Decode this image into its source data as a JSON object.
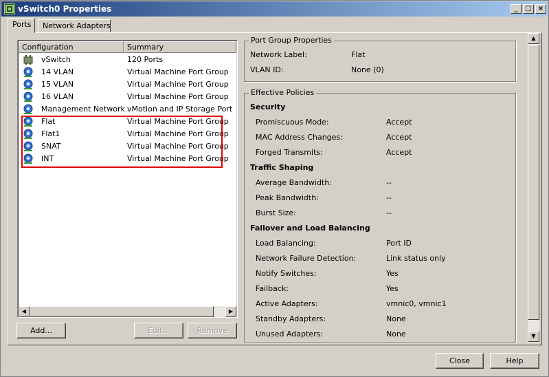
{
  "window": {
    "title": "vSwitch0 Properties",
    "controls": {
      "minimize": "_",
      "maximize": "□",
      "close": "×"
    }
  },
  "tabs": [
    {
      "label": "Ports",
      "active": true
    },
    {
      "label": "Network Adapters",
      "active": false
    }
  ],
  "ports_list": {
    "columns": [
      "Configuration",
      "Summary"
    ],
    "rows": [
      {
        "name": "vSwitch",
        "summary": "120 Ports",
        "icon": "vswitch-icon"
      },
      {
        "name": "14 VLAN",
        "summary": "Virtual Machine Port Group",
        "icon": "port-group-icon"
      },
      {
        "name": "15 VLAN",
        "summary": "Virtual Machine Port Group",
        "icon": "port-group-icon"
      },
      {
        "name": "16 VLAN",
        "summary": "Virtual Machine Port Group",
        "icon": "port-group-icon"
      },
      {
        "name": "Management Network",
        "summary": "vMotion and IP Storage Port",
        "icon": "port-group-icon"
      },
      {
        "name": "Flat",
        "summary": "Virtual Machine Port Group",
        "icon": "port-group-icon"
      },
      {
        "name": "Flat1",
        "summary": "Virtual Machine Port Group",
        "icon": "port-group-icon"
      },
      {
        "name": "SNAT",
        "summary": "Virtual Machine Port Group",
        "icon": "port-group-icon"
      },
      {
        "name": "INT",
        "summary": "Virtual Machine Port Group",
        "icon": "port-group-icon"
      }
    ]
  },
  "buttons": {
    "add": "Add...",
    "edit": "Edit...",
    "remove": "Remove",
    "close": "Close",
    "help": "Help"
  },
  "port_group_properties": {
    "legend": "Port Group Properties",
    "network_label_key": "Network Label:",
    "network_label_value": "Flat",
    "vlan_id_key": "VLAN ID:",
    "vlan_id_value": "None (0)"
  },
  "effective_policies": {
    "legend": "Effective Policies",
    "security": {
      "title": "Security",
      "promiscuous_key": "Promiscuous Mode:",
      "promiscuous_value": "Accept",
      "mac_key": "MAC Address Changes:",
      "mac_value": "Accept",
      "forged_key": "Forged Transmits:",
      "forged_value": "Accept"
    },
    "traffic_shaping": {
      "title": "Traffic Shaping",
      "avg_key": "Average Bandwidth:",
      "avg_value": "--",
      "peak_key": "Peak Bandwidth:",
      "peak_value": "--",
      "burst_key": "Burst Size:",
      "burst_value": "--"
    },
    "failover": {
      "title": "Failover and Load Balancing",
      "lb_key": "Load Balancing:",
      "lb_value": "Port ID",
      "nfd_key": "Network Failure Detection:",
      "nfd_value": "Link status only",
      "notify_key": "Notify Switches:",
      "notify_value": "Yes",
      "failback_key": "Failback:",
      "failback_value": "Yes",
      "active_key": "Active Adapters:",
      "active_value": "vmnic0, vmnic1",
      "standby_key": "Standby Adapters:",
      "standby_value": "None",
      "unused_key": "Unused Adapters:",
      "unused_value": "None"
    }
  },
  "colors": {
    "title_gradient_start": "#1c3d7a",
    "title_gradient_end": "#a6caf0",
    "highlight_border": "#e00000"
  }
}
